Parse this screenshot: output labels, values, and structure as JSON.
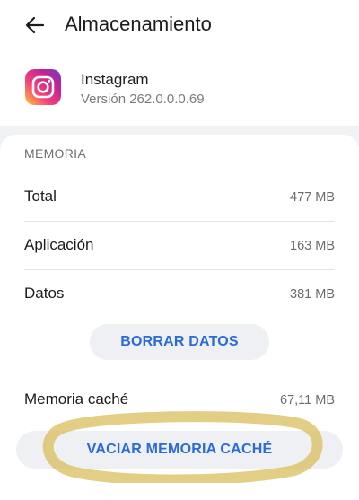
{
  "header": {
    "title": "Almacenamiento",
    "back_icon": "back-arrow-icon"
  },
  "app": {
    "name": "Instagram",
    "version": "Versión 262.0.0.0.69",
    "icon": "instagram-logo-icon"
  },
  "memory": {
    "section_title": "MEMORIA",
    "rows": [
      {
        "label": "Total",
        "value": "477 MB"
      },
      {
        "label": "Aplicación",
        "value": "163 MB"
      },
      {
        "label": "Datos",
        "value": "381 MB"
      }
    ],
    "clear_data_label": "BORRAR DATOS",
    "cache_label": "Memoria caché",
    "cache_value": "67,11 MB",
    "clear_cache_label": "VACIAR MEMORIA CACHÉ"
  },
  "colors": {
    "accent": "#2a6ad9",
    "highlight": "#d9bd5c",
    "background": "#f1f2f4"
  }
}
